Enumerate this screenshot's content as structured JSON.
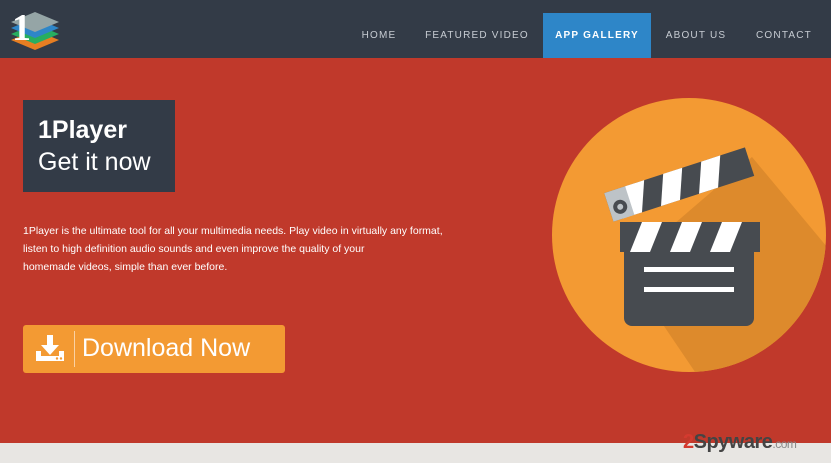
{
  "nav": {
    "logo_text": "1",
    "items": [
      {
        "label": "HOME"
      },
      {
        "label": "FEATURED VIDEO"
      },
      {
        "label": "APP GALLERY"
      },
      {
        "label": "ABOUT US"
      },
      {
        "label": "CONTACT"
      }
    ],
    "active": "APP GALLERY"
  },
  "hero": {
    "badge_title": "1Player",
    "badge_subtitle": "Get it now",
    "description_lines": [
      "1Player is the ultimate tool for all your multimedia needs. Play video in virtually any format,",
      "listen to high definition audio sounds and even improve the quality of your",
      "homemade videos, simple than ever before."
    ],
    "download_label": "Download Now",
    "download_icon": "download-tray-icon",
    "illustration_icon": "film-clapperboard-icon"
  },
  "watermark": {
    "prefix": "2",
    "name": "Spyware",
    "domain": ".com"
  },
  "colors": {
    "nav_bg": "#333b47",
    "nav_active": "#2e86c8",
    "hero_bg": "#c0392b",
    "accent_orange": "#f39a33",
    "badge_bg": "#333b47"
  }
}
